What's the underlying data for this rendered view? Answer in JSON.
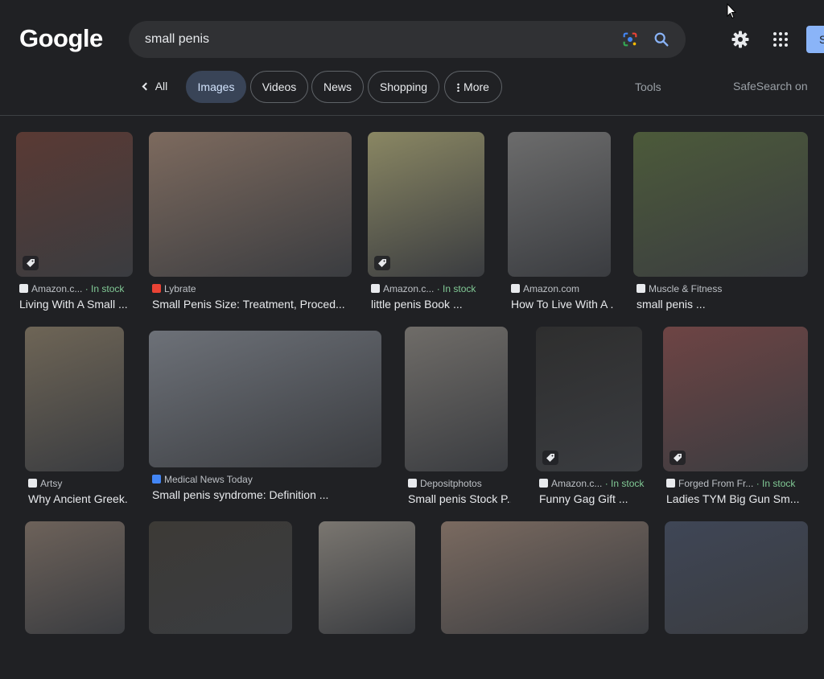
{
  "logo": "Google",
  "search": {
    "query": "small penis"
  },
  "header": {
    "signin_label": "S"
  },
  "tabs": [
    {
      "label": "All"
    },
    {
      "label": "Images"
    },
    {
      "label": "Videos"
    },
    {
      "label": "News"
    },
    {
      "label": "Shopping"
    },
    {
      "label": "More"
    }
  ],
  "tools_label": "Tools",
  "safesearch_label": "SafeSearch on",
  "results": [
    {
      "source": "Amazon.c...",
      "stock": "· In stock",
      "title": "Living With A Small ..."
    },
    {
      "source": "Lybrate",
      "stock": "",
      "title": "Small Penis Size: Treatment, Proced..."
    },
    {
      "source": "Amazon.c...",
      "stock": "· In stock",
      "title": "little penis Book ..."
    },
    {
      "source": "Amazon.com",
      "stock": "",
      "title": "How To Live With A ..."
    },
    {
      "source": "Muscle & Fitness",
      "stock": "",
      "title": "small penis ..."
    },
    {
      "source": "Artsy",
      "stock": "",
      "title": "Why Ancient Greek..."
    },
    {
      "source": "Medical News Today",
      "stock": "",
      "title": "Small penis syndrome: Definition ..."
    },
    {
      "source": "Depositphotos",
      "stock": "",
      "title": "Small penis Stock P..."
    },
    {
      "source": "Amazon.c...",
      "stock": "· In stock",
      "title": "Funny Gag Gift ..."
    },
    {
      "source": "Forged From Fr...",
      "stock": "· In stock",
      "title": "Ladies TYM Big Gun Sm..."
    },
    {
      "source": "",
      "stock": "",
      "title": ""
    },
    {
      "source": "",
      "stock": "",
      "title": ""
    },
    {
      "source": "",
      "stock": "",
      "title": ""
    },
    {
      "source": "",
      "stock": "",
      "title": ""
    },
    {
      "source": "",
      "stock": "",
      "title": ""
    }
  ]
}
